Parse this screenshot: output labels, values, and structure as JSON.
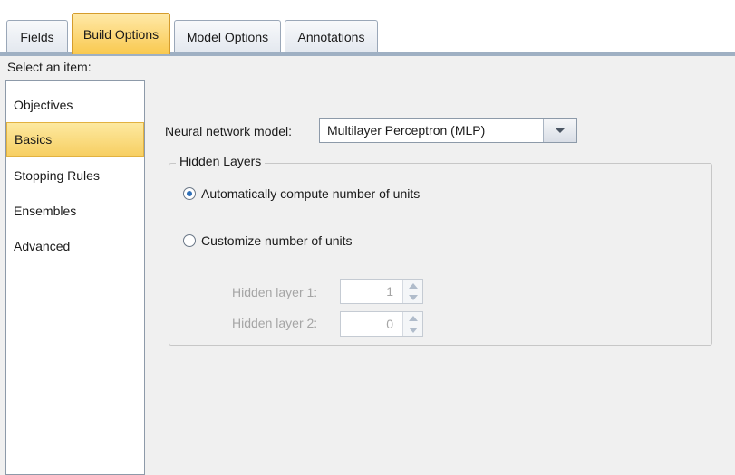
{
  "tabs": [
    {
      "label": "Fields",
      "active": false
    },
    {
      "label": "Build Options",
      "active": true
    },
    {
      "label": "Model Options",
      "active": false
    },
    {
      "label": "Annotations",
      "active": false
    }
  ],
  "left_panel": {
    "select_label": "Select an item:",
    "items": [
      {
        "label": "Objectives",
        "selected": false
      },
      {
        "label": "Basics",
        "selected": true
      },
      {
        "label": "Stopping Rules",
        "selected": false
      },
      {
        "label": "Ensembles",
        "selected": false
      },
      {
        "label": "Advanced",
        "selected": false
      }
    ]
  },
  "basics": {
    "model_label": "Neural network model:",
    "model_value": "Multilayer Perceptron (MLP)",
    "hidden_layers_title": "Hidden Layers",
    "radio_auto": "Automatically compute number of units",
    "radio_custom": "Customize number of units",
    "auto_selected": true,
    "hidden_layer_1_label": "Hidden layer 1:",
    "hidden_layer_1_value": "1",
    "hidden_layer_2_label": "Hidden layer 2:",
    "hidden_layer_2_value": "0"
  },
  "colors": {
    "active_tab": "#f9c94f",
    "selected_item": "#f7cf63",
    "radio_dot": "#2f6fb7"
  }
}
